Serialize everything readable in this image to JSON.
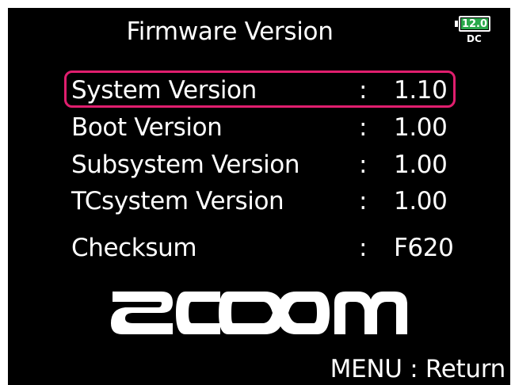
{
  "screen": {
    "title": "Firmware Version",
    "battery": {
      "voltage": "12.0",
      "source": "DC",
      "fill_color": "#2aa84a"
    },
    "rows": [
      {
        "label": "System Version",
        "separator": ":",
        "value": "1.10",
        "selected": true
      },
      {
        "label": "Boot Version",
        "separator": ":",
        "value": "1.00",
        "selected": false
      },
      {
        "label": "Subsystem Version",
        "separator": ":",
        "value": "1.00",
        "selected": false
      },
      {
        "label": "TCsystem Version",
        "separator": ":",
        "value": "1.00",
        "selected": false
      },
      {
        "label": "Checksum",
        "separator": ":",
        "value": "F620",
        "selected": false
      }
    ],
    "logo": "ZOOM",
    "footer": "MENU : Return",
    "selection_color": "#e01e6e"
  }
}
